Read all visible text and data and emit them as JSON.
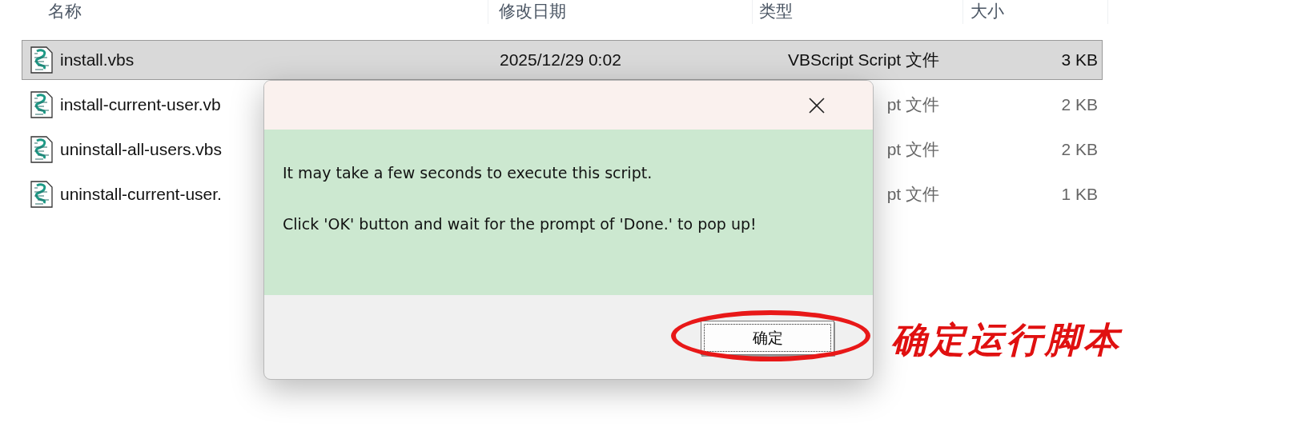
{
  "columns": [
    {
      "label": "名称"
    },
    {
      "label": "修改日期"
    },
    {
      "label": "类型"
    },
    {
      "label": "大小"
    }
  ],
  "rows": [
    {
      "name": "install.vbs",
      "modified": "2025/12/29 0:02",
      "type": "VBScript Script 文件",
      "size": "3 KB",
      "selected": true
    },
    {
      "name": "install-current-user.vb",
      "type": "pt 文件",
      "size": "2 KB",
      "selected": false
    },
    {
      "name": "uninstall-all-users.vbs",
      "type": "pt 文件",
      "size": "2 KB",
      "selected": false
    },
    {
      "name": "uninstall-current-user.",
      "type": "pt 文件",
      "size": "1 KB",
      "selected": false
    }
  ],
  "dialog": {
    "messages": [
      "It may take a few seconds to execute this script.",
      "Click 'OK' button and wait for the prompt of 'Done.' to pop up!"
    ],
    "button": "确定"
  },
  "annotation": {
    "text": "确定运行脚本"
  }
}
